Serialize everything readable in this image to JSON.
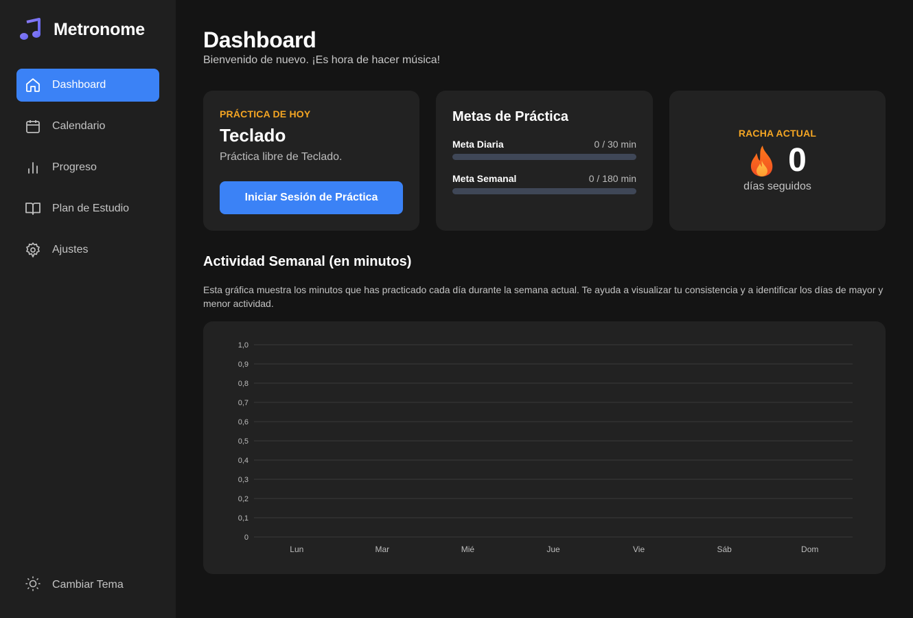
{
  "app": {
    "name": "Metronome",
    "logo_icon": "music-note-icon",
    "accent": "#3b82f6",
    "highlight": "#f5a623"
  },
  "sidebar": {
    "items": [
      {
        "label": "Dashboard",
        "icon": "home-icon",
        "active": true
      },
      {
        "label": "Calendario",
        "icon": "calendar-icon",
        "active": false
      },
      {
        "label": "Progreso",
        "icon": "bar-chart-icon",
        "active": false
      },
      {
        "label": "Plan de Estudio",
        "icon": "book-icon",
        "active": false
      },
      {
        "label": "Ajustes",
        "icon": "gear-icon",
        "active": false
      }
    ],
    "theme_toggle": {
      "label": "Cambiar Tema",
      "icon": "sun-icon"
    }
  },
  "header": {
    "title": "Dashboard",
    "subtitle": "Bienvenido de nuevo. ¡Es hora de hacer música!"
  },
  "today": {
    "eyebrow": "PRÁCTICA DE HOY",
    "instrument": "Teclado",
    "description": "Práctica libre de Teclado.",
    "button_label": "Iniciar Sesión de Práctica"
  },
  "goals": {
    "title": "Metas de Práctica",
    "items": [
      {
        "label": "Meta Diaria",
        "value_text": "0 / 30 min",
        "progress": 0
      },
      {
        "label": "Meta Semanal",
        "value_text": "0 / 180 min",
        "progress": 0
      }
    ]
  },
  "streak": {
    "eyebrow": "RACHA ACTUAL",
    "icon": "fire-icon",
    "count": "0",
    "caption": "días seguidos"
  },
  "activity": {
    "title": "Actividad Semanal (en minutos)",
    "description": "Esta gráfica muestra los minutos que has practicado cada día durante la semana actual. Te ayuda a visualizar tu consistencia y a identificar los días de mayor y menor actividad."
  },
  "chart_data": {
    "type": "bar",
    "categories": [
      "Lun",
      "Mar",
      "Mié",
      "Jue",
      "Vie",
      "Sáb",
      "Dom"
    ],
    "values": [
      0,
      0,
      0,
      0,
      0,
      0,
      0
    ],
    "ylim": [
      0,
      1
    ],
    "y_ticks": [
      "0",
      "0,1",
      "0,2",
      "0,3",
      "0,4",
      "0,5",
      "0,6",
      "0,7",
      "0,8",
      "0,9",
      "1,0"
    ],
    "grid": true
  }
}
